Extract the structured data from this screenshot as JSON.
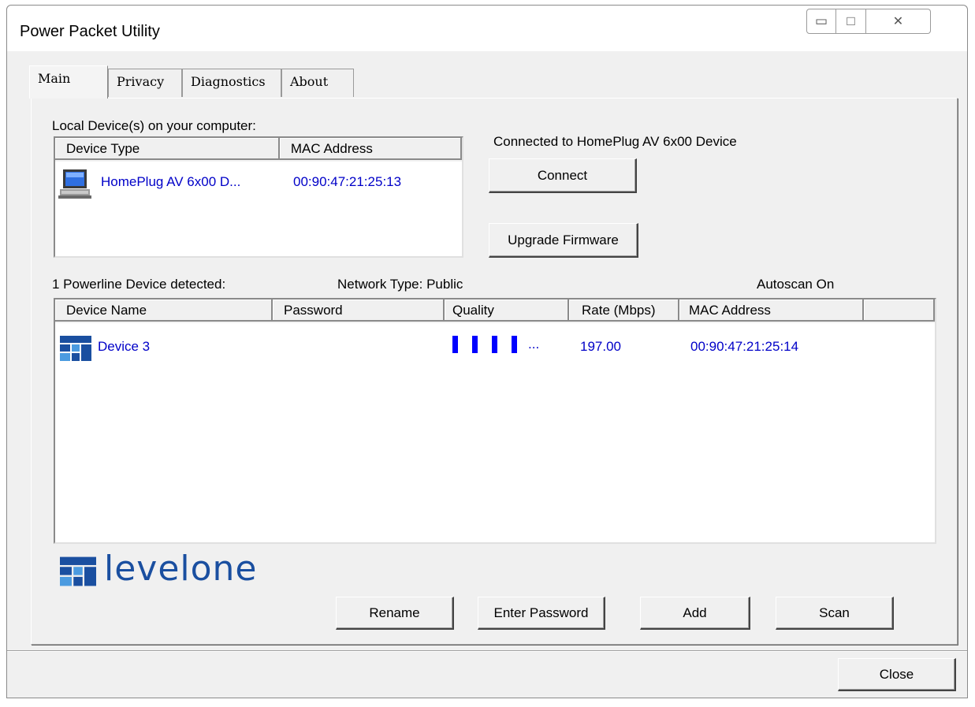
{
  "window": {
    "title": "Power Packet Utility",
    "min_glyph": "▭",
    "max_glyph": "□",
    "close_glyph": "✕"
  },
  "tabs": [
    "Main",
    "Privacy",
    "Diagnostics",
    "About"
  ],
  "local": {
    "label": "Local Device(s) on your computer:",
    "columns": [
      "Device Type",
      "MAC Address"
    ],
    "rows": [
      {
        "icon": "computer-icon",
        "type": "HomePlug AV 6x00 D...",
        "mac": "00:90:47:21:25:13"
      }
    ]
  },
  "connection": {
    "status": "Connected to HomePlug AV 6x00 Device",
    "connect_label": "Connect",
    "upgrade_label": "Upgrade Firmware"
  },
  "powerline": {
    "detected": "1 Powerline Device detected:",
    "network_type": "Network Type: Public",
    "autoscan": "Autoscan On",
    "columns": [
      "Device Name",
      "Password",
      "Quality",
      "Rate (Mbps)",
      "MAC Address"
    ],
    "rows": [
      {
        "icon": "levelone-device-icon",
        "name": "Device 3",
        "password": "",
        "quality_bars": 4,
        "quality_suffix": "...",
        "rate": "197.00",
        "mac": "00:90:47:21:25:14"
      }
    ]
  },
  "logo": {
    "text": "levelone",
    "colors": {
      "brand_blue": "#1a4fa0",
      "light_blue": "#4b9be0"
    }
  },
  "actions": {
    "rename": "Rename",
    "enter_password": "Enter Password",
    "add": "Add",
    "scan": "Scan"
  },
  "footer": {
    "close": "Close"
  }
}
